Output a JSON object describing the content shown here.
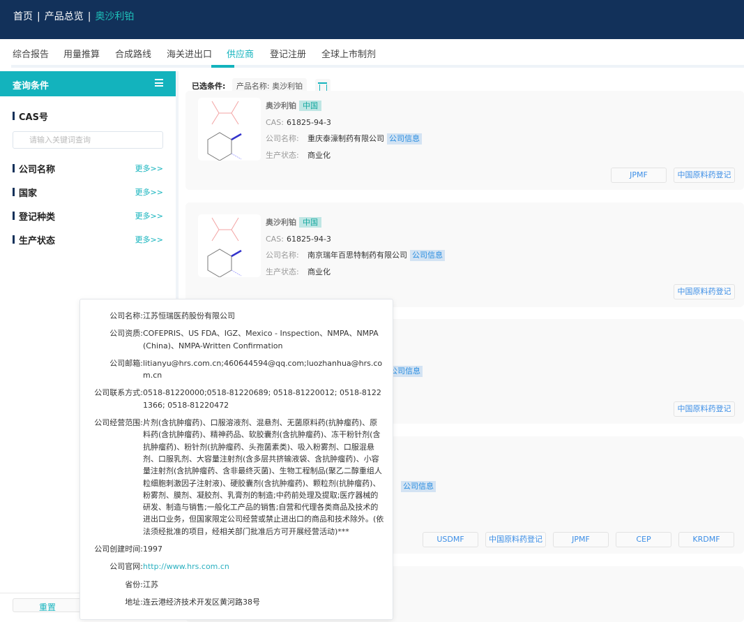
{
  "breadcrumb": {
    "home": "首页",
    "sep": "|",
    "overview": "产品总览",
    "current": "奥沙利铂"
  },
  "tabs": [
    "综合报告",
    "用量推算",
    "合成路线",
    "海关进出口",
    "供应商",
    "登记注册",
    "全球上市制剂"
  ],
  "active_tab": "供应商",
  "sidebar": {
    "title": "查询条件",
    "cas_label": "CAS号",
    "cas_placeholder": "请输入关键词查询",
    "more": "更多>>",
    "sections": [
      "公司名称",
      "国家",
      "登记种类",
      "生产状态"
    ],
    "reset": "重置"
  },
  "filter": {
    "label": "已选条件:",
    "chip": "产品名称:  奥沙利铂"
  },
  "labels": {
    "cas": "CAS:",
    "company": "公司名称:",
    "status": "生产状态:",
    "company_info": "公司信息"
  },
  "cards": [
    {
      "name": "奥沙利铂",
      "country": "中国",
      "cas": "61825-94-3",
      "company": "重庆泰濠制药有限公司",
      "status": "商业化",
      "buttons": [
        "JPMF",
        "中国原料药登记"
      ]
    },
    {
      "name": "奥沙利铂",
      "country": "中国",
      "cas": "61825-94-3",
      "company": "南京瑞年百思特制药有限公司",
      "status": "商业化",
      "buttons": [
        "中国原料药登记"
      ]
    },
    {
      "buttons": [
        "中国原料药登记"
      ]
    },
    {
      "buttons": [
        "USDMF",
        "中国原料药登记",
        "JPMF",
        "CEP",
        "KRDMF"
      ]
    }
  ],
  "popover": [
    {
      "k": "公司名称:",
      "v": "江苏恒瑞医药股份有限公司"
    },
    {
      "k": "公司资质:",
      "v": "COFEPRIS、US FDA、IGZ、Mexico - Inspection、NMPA、NMPA (China)、NMPA-Written Confirmation"
    },
    {
      "k": "公司邮箱:",
      "v": "litianyu@hrs.com.cn;460644594@qq.com;luozhanhua@hrs.com.cn"
    },
    {
      "k": "公司联系方式:",
      "v": "0518-81220000;0518-81220689; 0518-81220012; 0518-81221366; 0518-81220472"
    },
    {
      "k": "公司经营范围:",
      "v": "片剂(含抗肿瘤药)、口服溶液剂、混悬剂、无菌原料药(抗肿瘤药)、原料药(含抗肿瘤药)、精神药品、软胶囊剂(含抗肿瘤药)、冻干粉针剂(含抗肿瘤药)、粉针剂(抗肿瘤药、头孢菌素类)、吸入粉雾剂、口服混悬剂、口服乳剂、大容量注射剂(含多层共挤输液袋、含抗肿瘤药)、小容量注射剂(含抗肿瘤药、含非最终灭菌)、生物工程制品(聚乙二醇重组人粒细胞刺激因子注射液)、硬胶囊剂(含抗肿瘤药)、颗粒剂(抗肿瘤药)、粉雾剂、膜剂、凝胶剂、乳膏剂的制造;中药前处理及提取;医疗器械的研发、制造与销售;一般化工产品的销售;自营和代理各类商品及技术的进出口业务，但国家限定公司经营或禁止进出口的商品和技术除外。(依法须经批准的项目，经相关部门批准后方可开展经营活动)***"
    },
    {
      "k": "公司创建时间:",
      "v": "1997"
    },
    {
      "k": "公司官网:",
      "v": "http://www.hrs.com.cn"
    },
    {
      "k": "省份:",
      "v": "江苏"
    },
    {
      "k": "地址:",
      "v": "连云港经济技术开发区黄河路38号"
    }
  ],
  "colors": {
    "header": "#12315a",
    "accent": "#13b3bd",
    "link": "#3c8ee6"
  }
}
